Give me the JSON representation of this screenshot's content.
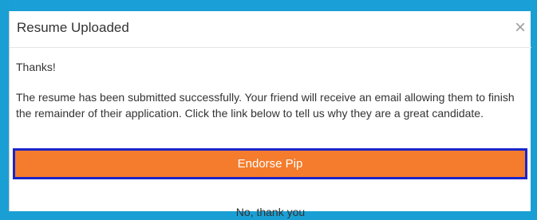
{
  "modal": {
    "title": "Resume Uploaded",
    "close_label": "×",
    "thanks_text": "Thanks!",
    "message": "The resume has been submitted successfully. Your friend will receive an email allowing them to finish the remainder of their application. Click the link below to tell us why they are a great candidate.",
    "endorse_label": "Endorse Pip",
    "decline_label": "No, thank you"
  },
  "colors": {
    "backdrop": "#1a9fd4",
    "endorse_button": "#f47c2c",
    "focus_outline": "#1a24c8"
  }
}
